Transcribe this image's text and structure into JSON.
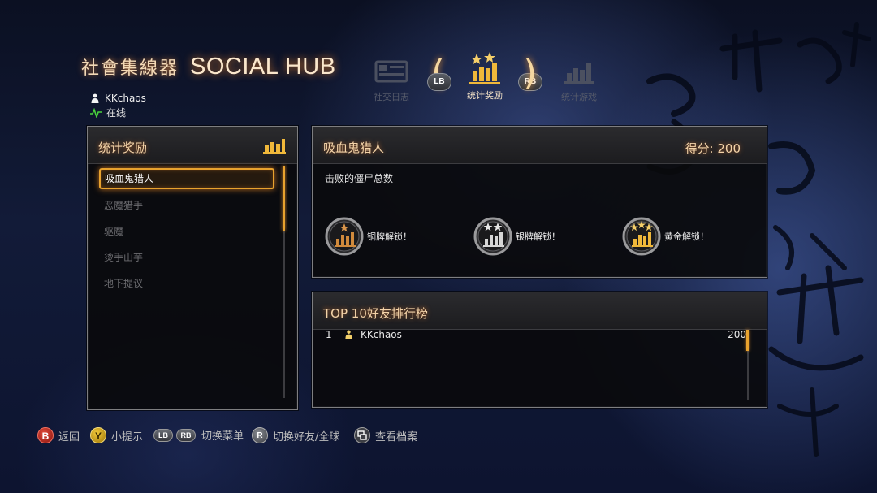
{
  "header": {
    "title_cn": "社會集線器",
    "title_en": "SOCIAL HUB",
    "username": "KKchaos",
    "status": "在线"
  },
  "nav": {
    "items": [
      {
        "label": "社交日志",
        "icon": "social-journal-icon",
        "state": "dim"
      },
      {
        "label": "统计奖励",
        "icon": "stats-awards-icon",
        "state": "active"
      },
      {
        "label": "统计游戏",
        "icon": "stats-games-icon",
        "state": "dim"
      }
    ],
    "lb_label": "LB",
    "rb_label": "RB"
  },
  "awards_panel": {
    "title": "统计奖励",
    "title_icon": "bar-chart-icon",
    "items": [
      {
        "label": "吸血鬼猎人",
        "selected": true
      },
      {
        "label": "恶魔猎手",
        "selected": false
      },
      {
        "label": "驱魔",
        "selected": false
      },
      {
        "label": "烫手山芋",
        "selected": false
      },
      {
        "label": "地下提议",
        "selected": false
      }
    ]
  },
  "detail": {
    "title": "吸血鬼猎人",
    "score": "得分: 200",
    "description": "击败的僵尸总数",
    "medals": [
      {
        "label": "铜牌解锁！",
        "tier": "bronze",
        "stars": 1,
        "icon": "bronze-medal-icon"
      },
      {
        "label": "银牌解锁！",
        "tier": "silver",
        "stars": 2,
        "icon": "silver-medal-icon"
      },
      {
        "label": "黄金解锁！",
        "tier": "gold",
        "stars": 3,
        "icon": "gold-medal-icon"
      }
    ]
  },
  "leaderboard": {
    "title": "TOP 10好友排行榜",
    "rows": [
      {
        "rank": "1",
        "name": "KKchaos",
        "score": "200"
      }
    ]
  },
  "footer": {
    "hints": [
      {
        "button": "B",
        "label": "返回"
      },
      {
        "button": "Y",
        "label": "小提示"
      },
      {
        "button": "LB",
        "button2": "RB",
        "label": "切换菜单"
      },
      {
        "button": "R",
        "label": "切换好友/全球"
      },
      {
        "button": "view",
        "label": "查看档案"
      }
    ]
  },
  "colors": {
    "accent": "#e8a22e",
    "title_glow": "#ff8c28",
    "button_b": "#b3261e",
    "button_y": "#d4a514"
  }
}
